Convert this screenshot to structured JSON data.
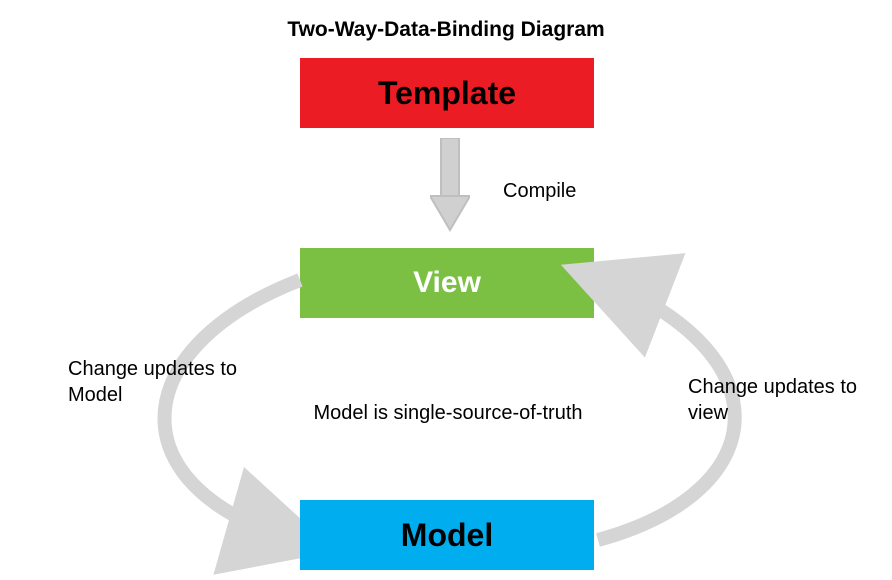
{
  "title": "Two-Way-Data-Binding Diagram",
  "boxes": {
    "template": "Template",
    "view": "View",
    "model": "Model"
  },
  "labels": {
    "compile": "Compile",
    "left": "Change updates to Model",
    "center": "Model is single-source-of-truth",
    "right": "Change updates to view"
  },
  "colors": {
    "template_bg": "#ec1c24",
    "view_bg": "#7bc043",
    "model_bg": "#00aeef",
    "arrow": "#cfcfcf"
  }
}
